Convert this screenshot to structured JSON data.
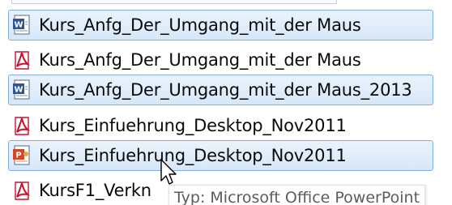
{
  "files": [
    {
      "name": "Kurs_Anfg_Der_Umgang_mit_der Maus",
      "icon": "word-document-icon",
      "selected": true
    },
    {
      "name": "Kurs_Anfg_Der_Umgang_mit_der Maus",
      "icon": "pdf-document-icon",
      "selected": false
    },
    {
      "name": "Kurs_Anfg_Der_Umgang_mit_der Maus_2013",
      "icon": "word-document-icon",
      "selected": true
    },
    {
      "name": "Kurs_Einfuehrung_Desktop_Nov2011",
      "icon": "pdf-document-icon",
      "selected": false
    },
    {
      "name": "Kurs_Einfuehrung_Desktop_Nov2011",
      "icon": "powerpoint-document-icon",
      "selected": true
    },
    {
      "name": "KursF1_Verkn",
      "icon": "pdf-document-icon",
      "selected": false
    }
  ],
  "tooltip": {
    "text": "Typ: Microsoft Office PowerPoint"
  },
  "colors": {
    "selection_border": "#84acdd",
    "selection_fill": "#d7e7f8",
    "pdf_red": "#c8102e",
    "word_blue": "#2b5797",
    "powerpoint_orange": "#d24726"
  }
}
